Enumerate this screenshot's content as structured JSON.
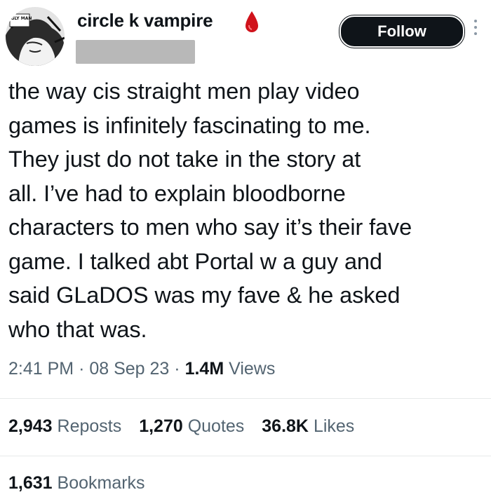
{
  "author": {
    "display_name": "circle k vampire",
    "avatar_text": "UGLY MAN",
    "emoji": "blood-drop-icon"
  },
  "follow_label": "Follow",
  "tweet_text": "the way cis straight men play video\ngames is infinitely fascinating to me.\nThey just do not take in the story at\nall. I’ve had to explain bloodborne\ncharacters to men who say it’s their fave\ngame. I talked abt Portal w a guy and\nsaid GLaDOS was my fave & he asked\nwho that was.",
  "meta": {
    "time": "2:41 PM",
    "separator": "·",
    "date": "08 Sep 23",
    "views_count": "1.4M",
    "views_label": "Views"
  },
  "stats": {
    "reposts_count": "2,943",
    "reposts_label": "Reposts",
    "quotes_count": "1,270",
    "quotes_label": "Quotes",
    "likes_count": "36.8K",
    "likes_label": "Likes",
    "bookmarks_count": "1,631",
    "bookmarks_label": "Bookmarks"
  },
  "colors": {
    "text_primary": "#0f1419",
    "text_secondary": "#536471",
    "follow_bg": "#0f1419",
    "drop_red": "#d0121b",
    "divider": "#e7e9ea",
    "redaction": "#b8b8b8"
  }
}
